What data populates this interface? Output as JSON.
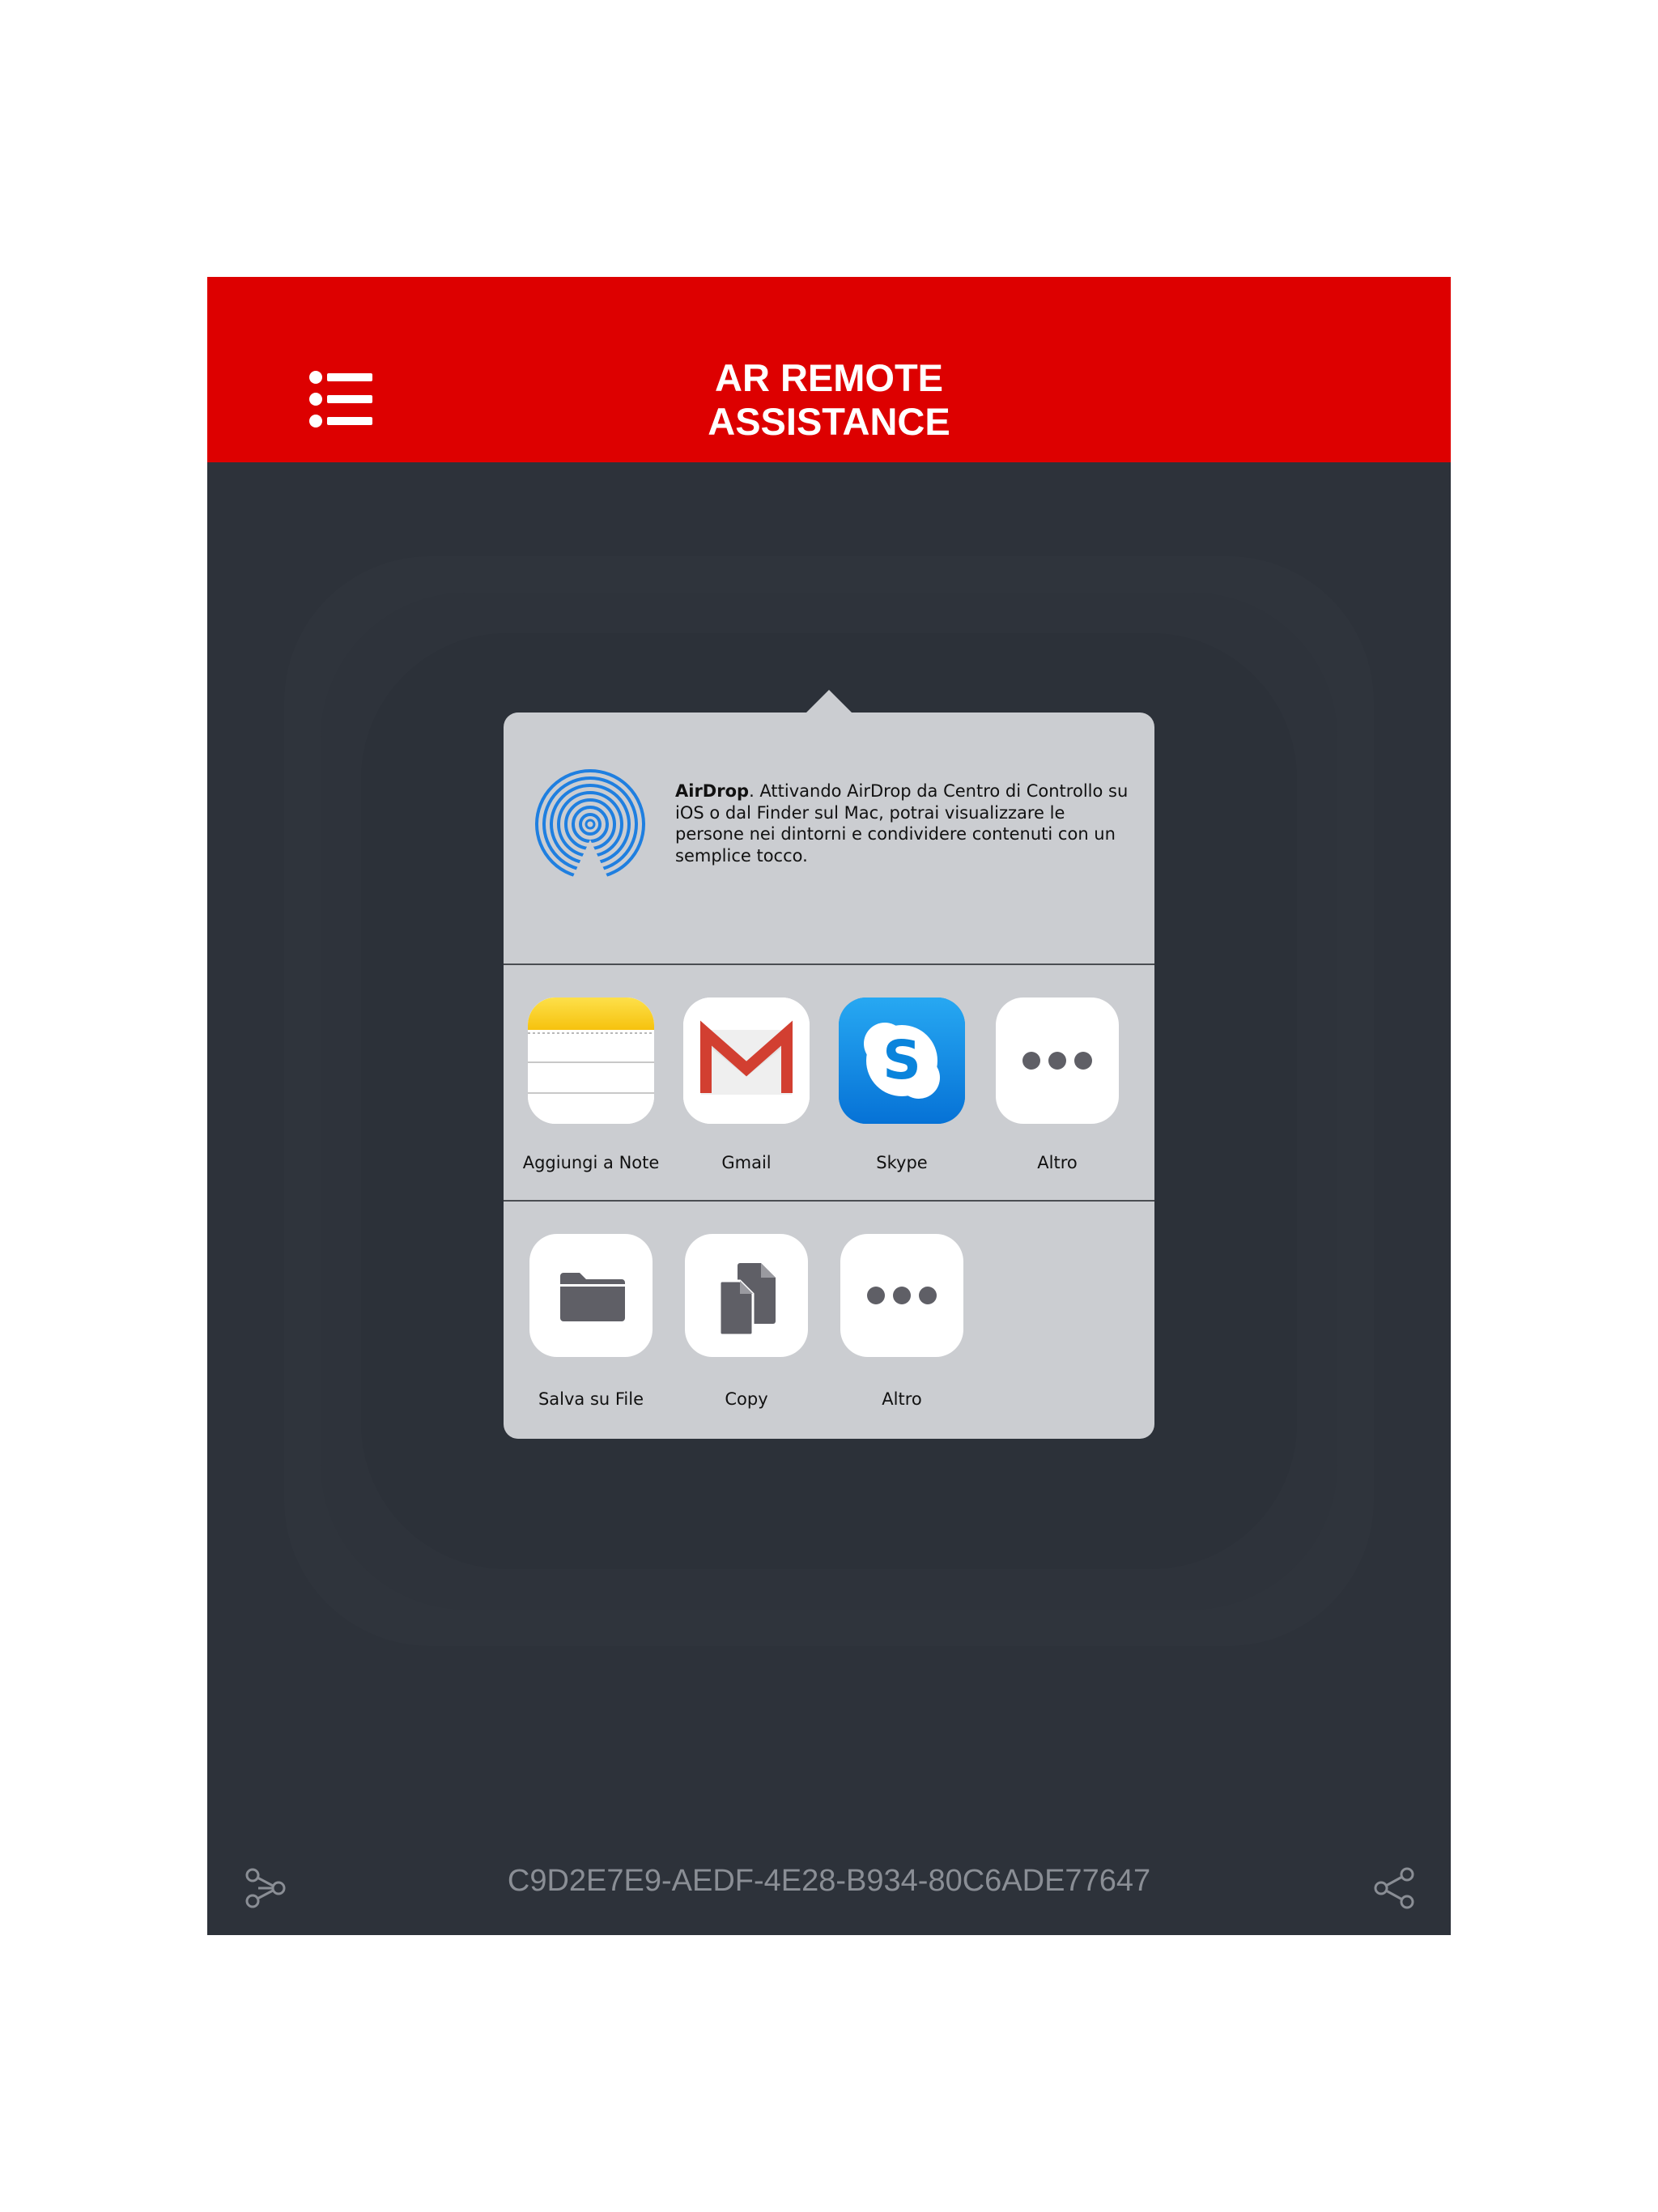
{
  "header": {
    "title_line1": "AR REMOTE",
    "title_line2": "ASSISTANCE",
    "menu_icon": "list-icon",
    "background": "#dd0000"
  },
  "share_sheet": {
    "airdrop": {
      "title": "AirDrop",
      "description": ". Attivando AirDrop da Centro di Controllo su iOS o dal Finder sul Mac, potrai visualizzare le persone nei dintorni e condividere contenuti con un semplice tocco.",
      "icon": "airdrop-icon"
    },
    "apps": [
      {
        "label": "Aggiungi a Note",
        "icon": "notes-icon"
      },
      {
        "label": "Gmail",
        "icon": "gmail-icon"
      },
      {
        "label": "Skype",
        "icon": "skype-icon"
      },
      {
        "label": "Altro",
        "icon": "more-icon"
      }
    ],
    "actions": [
      {
        "label": "Salva su File",
        "icon": "folder-icon"
      },
      {
        "label": "Copy",
        "icon": "copy-icon"
      },
      {
        "label": "Altro",
        "icon": "more-icon"
      }
    ]
  },
  "footer": {
    "device_id": "C9D2E7E9-AEDF-4E28-B934-80C6ADE77647",
    "left_icon": "connect-icon",
    "right_icon": "share-icon"
  },
  "colors": {
    "background": "#2d323a",
    "popover": "#cbcdd1",
    "accent": "#dd0000"
  }
}
